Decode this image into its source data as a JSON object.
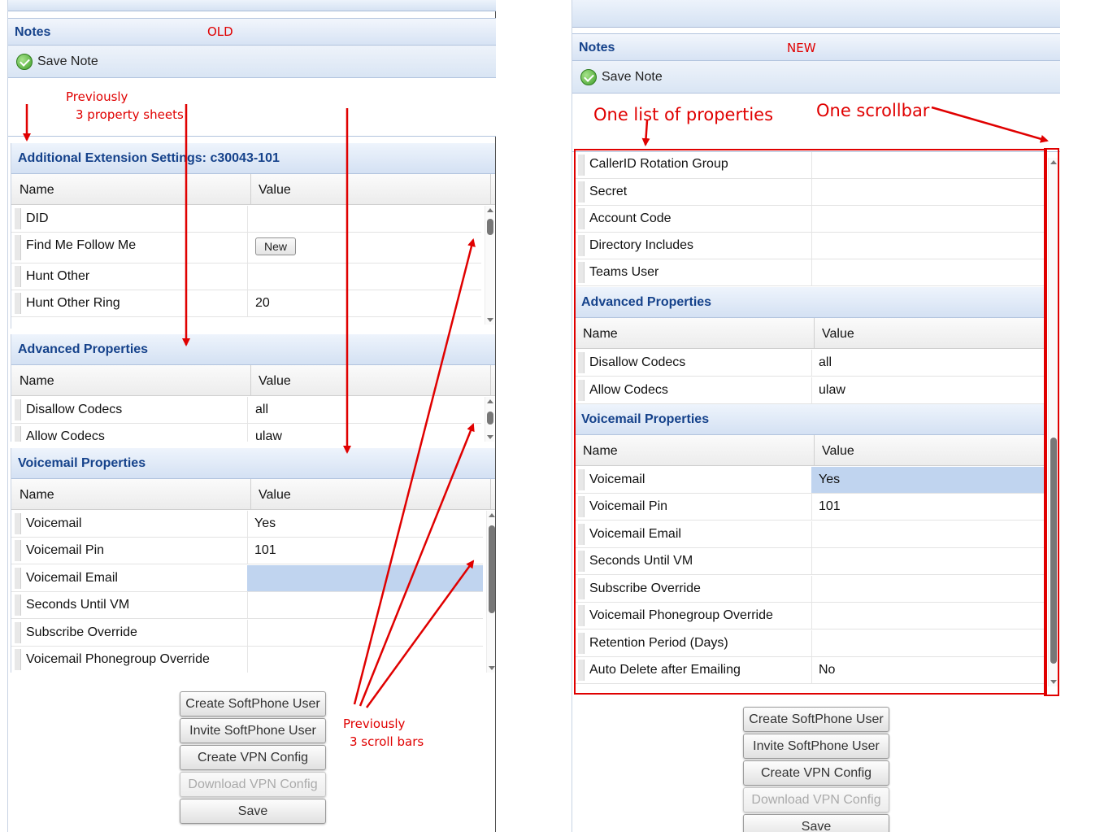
{
  "old": {
    "notes_title": "Notes",
    "tag": "OLD",
    "save_note": "Save Note",
    "ext_title": "Additional Extension Settings: c30043-101",
    "col_name": "Name",
    "col_value": "Value",
    "ext_rows": [
      {
        "name": "DID",
        "value": ""
      },
      {
        "name": "Find Me Follow Me",
        "value": "",
        "button": "New"
      },
      {
        "name": "Hunt Other",
        "value": ""
      },
      {
        "name": "Hunt Other Ring",
        "value": "20"
      }
    ],
    "adv_title": "Advanced Properties",
    "adv_rows": [
      {
        "name": "Disallow Codecs",
        "value": "all"
      },
      {
        "name": "Allow Codecs",
        "value": "ulaw"
      }
    ],
    "vm_title": "Voicemail Properties",
    "vm_rows": [
      {
        "name": "Voicemail",
        "value": "Yes"
      },
      {
        "name": "Voicemail Pin",
        "value": "101"
      },
      {
        "name": "Voicemail Email",
        "value": ""
      },
      {
        "name": "Seconds Until VM",
        "value": ""
      },
      {
        "name": "Subscribe Override",
        "value": ""
      },
      {
        "name": "Voicemail Phonegroup Override",
        "value": ""
      }
    ],
    "buttons": [
      "Create SoftPhone User",
      "Invite SoftPhone User",
      "Create VPN Config",
      "Download VPN Config",
      "Save"
    ]
  },
  "new": {
    "notes_title": "Notes",
    "tag": "NEW",
    "save_note": "Save Note",
    "top_rows": [
      {
        "name": "CallerID Rotation Group",
        "value": ""
      },
      {
        "name": "Secret",
        "value": ""
      },
      {
        "name": "Account Code",
        "value": ""
      },
      {
        "name": "Directory Includes",
        "value": ""
      },
      {
        "name": "Teams User",
        "value": ""
      }
    ],
    "adv_title": "Advanced Properties",
    "col_name": "Name",
    "col_value": "Value",
    "adv_rows": [
      {
        "name": "Disallow Codecs",
        "value": "all"
      },
      {
        "name": "Allow Codecs",
        "value": "ulaw"
      }
    ],
    "vm_title": "Voicemail Properties",
    "vm_rows": [
      {
        "name": "Voicemail",
        "value": "Yes"
      },
      {
        "name": "Voicemail Pin",
        "value": "101"
      },
      {
        "name": "Voicemail Email",
        "value": ""
      },
      {
        "name": "Seconds Until VM",
        "value": ""
      },
      {
        "name": "Subscribe Override",
        "value": ""
      },
      {
        "name": "Voicemail Phonegroup Override",
        "value": ""
      },
      {
        "name": "Retention Period (Days)",
        "value": ""
      },
      {
        "name": "Auto Delete after Emailing",
        "value": "No"
      }
    ],
    "buttons": [
      "Create SoftPhone User",
      "Invite SoftPhone User",
      "Create VPN Config",
      "Download VPN Config",
      "Save"
    ]
  },
  "annotations": {
    "prev_sheets_1": "Previously",
    "prev_sheets_2": "3 property sheets",
    "prev_scroll_1": "Previously",
    "prev_scroll_2": "3 scroll bars",
    "one_list": "One list of properties",
    "one_scrollbar": "One scrollbar",
    "color": "#e00000"
  }
}
